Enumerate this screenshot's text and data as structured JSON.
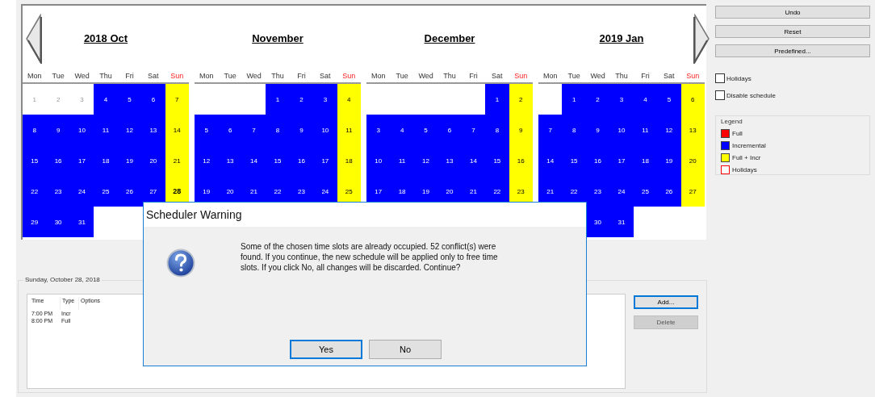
{
  "calendar": {
    "months": [
      {
        "title": "2018 Oct",
        "weekdays": [
          {
            "label": "Mon",
            "weekend": false
          },
          {
            "label": "Tue",
            "weekend": false
          },
          {
            "label": "Wed",
            "weekend": false
          },
          {
            "label": "Thu",
            "weekend": false
          },
          {
            "label": "Fri",
            "weekend": false
          },
          {
            "label": "Sat",
            "weekend": false
          },
          {
            "label": "Sun",
            "weekend": true
          }
        ],
        "weeks": [
          [
            {
              "day": "1",
              "kind": "past",
              "selected": false
            },
            {
              "day": "2",
              "kind": "past",
              "selected": false
            },
            {
              "day": "3",
              "kind": "past",
              "selected": false
            },
            {
              "day": "4",
              "kind": "incr",
              "selected": false
            },
            {
              "day": "5",
              "kind": "incr",
              "selected": false
            },
            {
              "day": "6",
              "kind": "incr",
              "selected": false
            },
            {
              "day": "7",
              "kind": "fullincr",
              "selected": false
            }
          ],
          [
            {
              "day": "8",
              "kind": "incr",
              "selected": false
            },
            {
              "day": "9",
              "kind": "incr",
              "selected": false
            },
            {
              "day": "10",
              "kind": "incr",
              "selected": false
            },
            {
              "day": "11",
              "kind": "incr",
              "selected": false
            },
            {
              "day": "12",
              "kind": "incr",
              "selected": false
            },
            {
              "day": "13",
              "kind": "incr",
              "selected": false
            },
            {
              "day": "14",
              "kind": "fullincr",
              "selected": false
            }
          ],
          [
            {
              "day": "15",
              "kind": "incr",
              "selected": false
            },
            {
              "day": "16",
              "kind": "incr",
              "selected": false
            },
            {
              "day": "17",
              "kind": "incr",
              "selected": false
            },
            {
              "day": "18",
              "kind": "incr",
              "selected": false
            },
            {
              "day": "19",
              "kind": "incr",
              "selected": false
            },
            {
              "day": "20",
              "kind": "incr",
              "selected": false
            },
            {
              "day": "21",
              "kind": "fullincr",
              "selected": false
            }
          ],
          [
            {
              "day": "22",
              "kind": "incr",
              "selected": false
            },
            {
              "day": "23",
              "kind": "incr",
              "selected": false
            },
            {
              "day": "24",
              "kind": "incr",
              "selected": false
            },
            {
              "day": "25",
              "kind": "incr",
              "selected": false
            },
            {
              "day": "26",
              "kind": "incr",
              "selected": false
            },
            {
              "day": "27",
              "kind": "incr",
              "selected": false
            },
            {
              "day": "28",
              "kind": "fullincr",
              "selected": true
            }
          ],
          [
            {
              "day": "29",
              "kind": "incr",
              "selected": false
            },
            {
              "day": "30",
              "kind": "incr",
              "selected": false
            },
            {
              "day": "31",
              "kind": "incr",
              "selected": false
            },
            {
              "kind": "empty"
            },
            {
              "kind": "empty"
            },
            {
              "kind": "empty"
            },
            {
              "kind": "empty"
            }
          ]
        ]
      },
      {
        "title": "November",
        "weekdays": [
          {
            "label": "Mon",
            "weekend": false
          },
          {
            "label": "Tue",
            "weekend": false
          },
          {
            "label": "Wed",
            "weekend": false
          },
          {
            "label": "Thu",
            "weekend": false
          },
          {
            "label": "Fri",
            "weekend": false
          },
          {
            "label": "Sat",
            "weekend": false
          },
          {
            "label": "Sun",
            "weekend": true
          }
        ],
        "weeks": [
          [
            {
              "kind": "empty"
            },
            {
              "kind": "empty"
            },
            {
              "kind": "empty"
            },
            {
              "day": "1",
              "kind": "incr",
              "selected": false
            },
            {
              "day": "2",
              "kind": "incr",
              "selected": false
            },
            {
              "day": "3",
              "kind": "incr",
              "selected": false
            },
            {
              "day": "4",
              "kind": "fullincr",
              "selected": false
            }
          ],
          [
            {
              "day": "5",
              "kind": "incr",
              "selected": false
            },
            {
              "day": "6",
              "kind": "incr",
              "selected": false
            },
            {
              "day": "7",
              "kind": "incr",
              "selected": false
            },
            {
              "day": "8",
              "kind": "incr",
              "selected": false
            },
            {
              "day": "9",
              "kind": "incr",
              "selected": false
            },
            {
              "day": "10",
              "kind": "incr",
              "selected": false
            },
            {
              "day": "11",
              "kind": "fullincr",
              "selected": false
            }
          ],
          [
            {
              "day": "12",
              "kind": "incr",
              "selected": false
            },
            {
              "day": "13",
              "kind": "incr",
              "selected": false
            },
            {
              "day": "14",
              "kind": "incr",
              "selected": false
            },
            {
              "day": "15",
              "kind": "incr",
              "selected": false
            },
            {
              "day": "16",
              "kind": "incr",
              "selected": false
            },
            {
              "day": "17",
              "kind": "incr",
              "selected": false
            },
            {
              "day": "18",
              "kind": "fullincr",
              "selected": false
            }
          ],
          [
            {
              "day": "19",
              "kind": "incr",
              "selected": false
            },
            {
              "day": "20",
              "kind": "incr",
              "selected": false
            },
            {
              "day": "21",
              "kind": "incr",
              "selected": false
            },
            {
              "day": "22",
              "kind": "incr",
              "selected": false
            },
            {
              "day": "23",
              "kind": "incr",
              "selected": false
            },
            {
              "day": "24",
              "kind": "incr",
              "selected": false
            },
            {
              "day": "25",
              "kind": "fullincr",
              "selected": false
            }
          ]
        ]
      },
      {
        "title": "December",
        "weekdays": [
          {
            "label": "Mon",
            "weekend": false
          },
          {
            "label": "Tue",
            "weekend": false
          },
          {
            "label": "Wed",
            "weekend": false
          },
          {
            "label": "Thu",
            "weekend": false
          },
          {
            "label": "Fri",
            "weekend": false
          },
          {
            "label": "Sat",
            "weekend": false
          },
          {
            "label": "Sun",
            "weekend": true
          }
        ],
        "weeks": [
          [
            {
              "kind": "empty"
            },
            {
              "kind": "empty"
            },
            {
              "kind": "empty"
            },
            {
              "kind": "empty"
            },
            {
              "kind": "empty"
            },
            {
              "day": "1",
              "kind": "incr",
              "selected": false
            },
            {
              "day": "2",
              "kind": "fullincr",
              "selected": false
            }
          ],
          [
            {
              "day": "3",
              "kind": "incr",
              "selected": false
            },
            {
              "day": "4",
              "kind": "incr",
              "selected": false
            },
            {
              "day": "5",
              "kind": "incr",
              "selected": false
            },
            {
              "day": "6",
              "kind": "incr",
              "selected": false
            },
            {
              "day": "7",
              "kind": "incr",
              "selected": false
            },
            {
              "day": "8",
              "kind": "incr",
              "selected": false
            },
            {
              "day": "9",
              "kind": "fullincr",
              "selected": false
            }
          ],
          [
            {
              "day": "10",
              "kind": "incr",
              "selected": false
            },
            {
              "day": "11",
              "kind": "incr",
              "selected": false
            },
            {
              "day": "12",
              "kind": "incr",
              "selected": false
            },
            {
              "day": "13",
              "kind": "incr",
              "selected": false
            },
            {
              "day": "14",
              "kind": "incr",
              "selected": false
            },
            {
              "day": "15",
              "kind": "incr",
              "selected": false
            },
            {
              "day": "16",
              "kind": "fullincr",
              "selected": false
            }
          ],
          [
            {
              "day": "17",
              "kind": "incr",
              "selected": false
            },
            {
              "day": "18",
              "kind": "incr",
              "selected": false
            },
            {
              "day": "19",
              "kind": "incr",
              "selected": false
            },
            {
              "day": "20",
              "kind": "incr",
              "selected": false
            },
            {
              "day": "21",
              "kind": "incr",
              "selected": false
            },
            {
              "day": "22",
              "kind": "incr",
              "selected": false
            },
            {
              "day": "23",
              "kind": "fullincr",
              "selected": false
            }
          ]
        ]
      },
      {
        "title": "2019 Jan",
        "weekdays": [
          {
            "label": "Mon",
            "weekend": false
          },
          {
            "label": "Tue",
            "weekend": false
          },
          {
            "label": "Wed",
            "weekend": false
          },
          {
            "label": "Thu",
            "weekend": false
          },
          {
            "label": "Fri",
            "weekend": false
          },
          {
            "label": "Sat",
            "weekend": false
          },
          {
            "label": "Sun",
            "weekend": true
          }
        ],
        "weeks": [
          [
            {
              "kind": "empty"
            },
            {
              "day": "1",
              "kind": "incr",
              "selected": false
            },
            {
              "day": "2",
              "kind": "incr",
              "selected": false
            },
            {
              "day": "3",
              "kind": "incr",
              "selected": false
            },
            {
              "day": "4",
              "kind": "incr",
              "selected": false
            },
            {
              "day": "5",
              "kind": "incr",
              "selected": false
            },
            {
              "day": "6",
              "kind": "fullincr",
              "selected": false
            }
          ],
          [
            {
              "day": "7",
              "kind": "incr",
              "selected": false
            },
            {
              "day": "8",
              "kind": "incr",
              "selected": false
            },
            {
              "day": "9",
              "kind": "incr",
              "selected": false
            },
            {
              "day": "10",
              "kind": "incr",
              "selected": false
            },
            {
              "day": "11",
              "kind": "incr",
              "selected": false
            },
            {
              "day": "12",
              "kind": "incr",
              "selected": false
            },
            {
              "day": "13",
              "kind": "fullincr",
              "selected": false
            }
          ],
          [
            {
              "day": "14",
              "kind": "incr",
              "selected": false
            },
            {
              "day": "15",
              "kind": "incr",
              "selected": false
            },
            {
              "day": "16",
              "kind": "incr",
              "selected": false
            },
            {
              "day": "17",
              "kind": "incr",
              "selected": false
            },
            {
              "day": "18",
              "kind": "incr",
              "selected": false
            },
            {
              "day": "19",
              "kind": "incr",
              "selected": false
            },
            {
              "day": "20",
              "kind": "fullincr",
              "selected": false
            }
          ],
          [
            {
              "day": "21",
              "kind": "incr",
              "selected": false
            },
            {
              "day": "22",
              "kind": "incr",
              "selected": false
            },
            {
              "day": "23",
              "kind": "incr",
              "selected": false
            },
            {
              "day": "24",
              "kind": "incr",
              "selected": false
            },
            {
              "day": "25",
              "kind": "incr",
              "selected": false
            },
            {
              "day": "26",
              "kind": "incr",
              "selected": false
            },
            {
              "day": "27",
              "kind": "fullincr",
              "selected": false
            }
          ],
          [
            {
              "kind": "covered"
            },
            {
              "kind": "covered"
            },
            {
              "day": "30",
              "kind": "incr",
              "selected": false
            },
            {
              "day": "31",
              "kind": "incr",
              "selected": false
            },
            {
              "kind": "empty"
            },
            {
              "kind": "empty"
            },
            {
              "kind": "empty"
            }
          ]
        ]
      }
    ]
  },
  "side_buttons": [
    {
      "label": "Undo"
    },
    {
      "label": "Reset"
    },
    {
      "label": "Predefined..."
    }
  ],
  "options": [
    {
      "label": "Holidays",
      "checked": false
    },
    {
      "label": "Disable schedule",
      "checked": false
    }
  ],
  "legend": {
    "title": "Legend",
    "items": [
      {
        "label": "Full",
        "kind": "fill",
        "color": "#ff0000"
      },
      {
        "label": "Incremental",
        "kind": "fill",
        "color": "#0000ff"
      },
      {
        "label": "Full + Incr",
        "kind": "fill",
        "color": "#ffff00"
      },
      {
        "label": "Holidays",
        "kind": "outline",
        "color": "#ff0000"
      }
    ]
  },
  "day_panel": {
    "title": "Sunday, October 28, 2018",
    "columns": [
      "Time",
      "Type",
      "Options"
    ],
    "rows": [
      [
        "7:00 PM",
        "Incr"
      ],
      [
        "8:00 PM",
        "Full"
      ]
    ],
    "buttons": [
      {
        "label": "Add...",
        "focused": true,
        "disabled": false
      },
      {
        "label": "Delete",
        "focused": false,
        "disabled": true
      }
    ]
  },
  "dialog": {
    "title": "Scheduler Warning",
    "message": "Some of the chosen time slots are already occupied. 52 conflict(s) were found. If you continue, the new schedule will be applied only to free time slots. If you click No, all changes will be discarded. Continue?",
    "buttons": [
      {
        "label": "Yes",
        "focused": true
      },
      {
        "label": "No",
        "focused": false
      }
    ]
  }
}
